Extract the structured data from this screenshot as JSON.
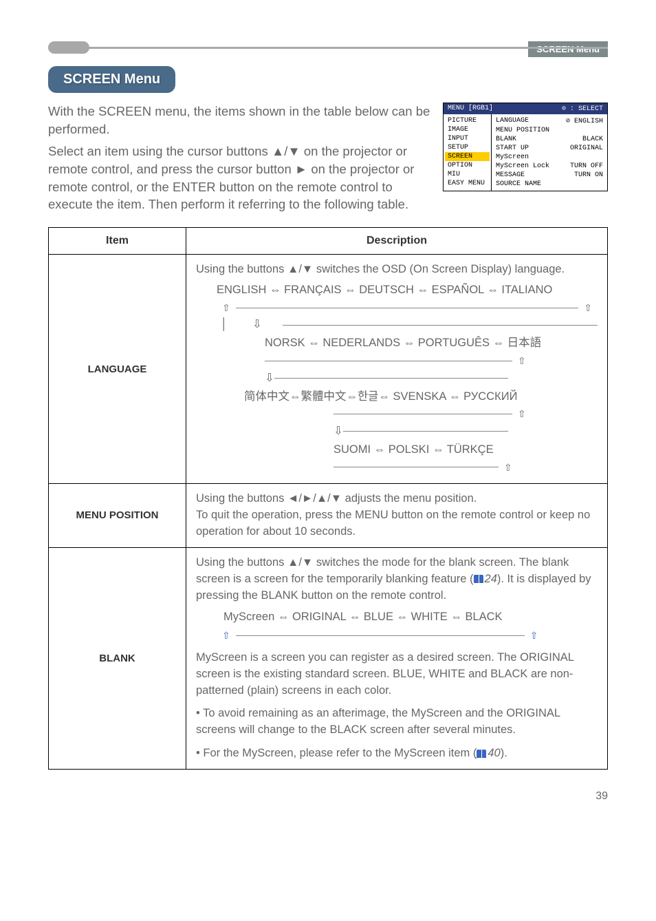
{
  "section_label": "SCREEN Menu",
  "title": "SCREEN Menu",
  "intro_p1": "With the SCREEN menu, the items shown in the table below can be performed.",
  "intro_p2": "Select an item using the cursor buttons ▲/▼ on the projector or remote control, and press the cursor button ► on the projector or remote control, or the ENTER button on the remote control to execute the item. Then perform it referring to the following table.",
  "osd": {
    "header_left": "MENU [RGB1]",
    "header_right": "⊙ : SELECT",
    "left_items": [
      "PICTURE",
      "IMAGE",
      "INPUT",
      "SETUP",
      "SCREEN",
      "OPTION",
      "MIU",
      "EASY MENU"
    ],
    "selected_index": 4,
    "right_rows": [
      {
        "l": "LANGUAGE",
        "r": "⊘ ENGLISH"
      },
      {
        "l": "MENU POSITION",
        "r": ""
      },
      {
        "l": "BLANK",
        "r": "BLACK"
      },
      {
        "l": "START UP",
        "r": "ORIGINAL"
      },
      {
        "l": "MyScreen",
        "r": ""
      },
      {
        "l": "MyScreen Lock",
        "r": "TURN OFF"
      },
      {
        "l": "MESSAGE",
        "r": "TURN ON"
      },
      {
        "l": "SOURCE NAME",
        "r": ""
      }
    ]
  },
  "table": {
    "head_item": "Item",
    "head_desc": "Description",
    "lang": {
      "item": "LANGUAGE",
      "line1": "Using the buttons ▲/▼ switches the OSD (On Screen Display) language.",
      "row1": "ENGLISH ⇔ FRANÇAIS ⇔ DEUTSCH ⇔ ESPAÑOL ⇔ ITALIANO",
      "row2": "NORSK ⇔ NEDERLANDS ⇔ PORTUGUÊS ⇔ 日本語",
      "row3": "简体中文⇔繁體中文⇔한글⇔ SVENSKA ⇔ РУССКИЙ",
      "row4": "SUOMI ⇔ POLSKI ⇔ TÜRKÇE"
    },
    "menupos": {
      "item": "MENU POSITION",
      "desc": "Using the buttons ◄/►/▲/▼ adjusts the menu position.\nTo quit the operation, press the MENU button on the remote control or keep no operation for about 10 seconds."
    },
    "blank": {
      "item": "BLANK",
      "p1a": "Using the buttons ▲/▼ switches the mode for the blank screen. The blank screen is a screen for the temporarily blanking feature (",
      "p1ref": "24",
      "p1b": "). It is displayed by pressing the BLANK button on the remote control.",
      "cycle": "MyScreen ⇔ ORIGINAL ⇔ BLUE ⇔ WHITE ⇔ BLACK",
      "p2": "MyScreen is a screen you can register as a desired screen. The ORIGINAL screen is the existing standard screen. BLUE, WHITE and BLACK are non-patterned (plain) screens in each color.",
      "p3": "• To avoid remaining as an afterimage, the MyScreen and the ORIGINAL screens will change to the BLACK screen after several minutes.",
      "p4a": "• For the MyScreen, please refer to the MyScreen item (",
      "p4ref": "40",
      "p4b": ")."
    }
  },
  "page_number": "39"
}
